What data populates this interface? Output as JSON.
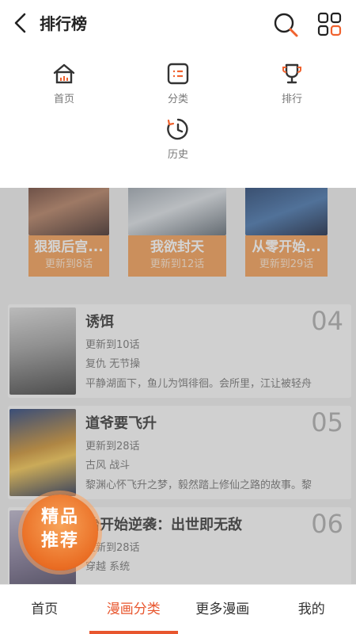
{
  "header": {
    "title": "排行榜"
  },
  "menu": [
    {
      "label": "首页",
      "icon": "home-icon"
    },
    {
      "label": "分类",
      "icon": "category-icon"
    },
    {
      "label": "排行",
      "icon": "trophy-icon"
    },
    {
      "label": "历史",
      "icon": "history-icon"
    }
  ],
  "podium": [
    {
      "title": "狠狠后宫...",
      "update": "更新到8话"
    },
    {
      "title": "我欲封天",
      "update": "更新到12话"
    },
    {
      "title": "从零开始...",
      "update": "更新到29话"
    }
  ],
  "ranking": [
    {
      "title": "诱饵",
      "rank": "04",
      "update": "更新到10话",
      "tags": "复仇 无节操",
      "desc": "平静湖面下，鱼儿为饵徘徊。会所里，江让被轻舟"
    },
    {
      "title": "道爷要飞升",
      "rank": "05",
      "update": "更新到28话",
      "tags": "古风 战斗",
      "desc": "黎渊心怀飞升之梦，毅然踏上修仙之路的故事。黎"
    },
    {
      "title": "胎开始逆袭：出世即无敌",
      "rank": "06",
      "update": "更新到28话",
      "tags": "穿越 系统",
      "desc": ""
    }
  ],
  "badge": {
    "line1": "精品",
    "line2": "推荐"
  },
  "bottom_nav": [
    {
      "label": "首页"
    },
    {
      "label": "漫画分类"
    },
    {
      "label": "更多漫画"
    },
    {
      "label": "我的"
    }
  ],
  "colors": {
    "accent": "#e8562e",
    "podium_label": "#f29a4e",
    "badge": "#ea6e24"
  }
}
